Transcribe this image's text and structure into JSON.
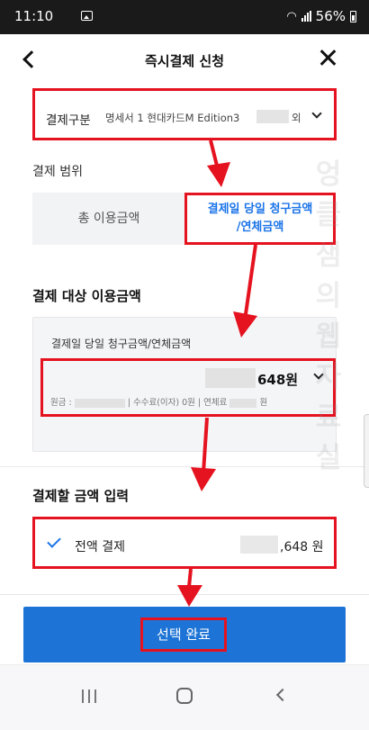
{
  "status_bar": {
    "time": "11:10",
    "battery": "56%"
  },
  "header": {
    "title": "즉시결제 신청"
  },
  "payment_type": {
    "label": "결제구분",
    "value": "명세서 1 현대카드M Edition3",
    "extra": "외"
  },
  "range": {
    "label": "결제 범위",
    "option_total": "총 이용금액",
    "option_due_line1": "결제일 당일 청구금액",
    "option_due_line2": "/연체금액"
  },
  "target": {
    "title": "결제 대상 이용금액",
    "card_label": "결제일 당일 청구금액/연체금액",
    "amount": "648원",
    "principal_label": "원금 :",
    "fee_text": "| 수수료(이자) 0원",
    "overdue_label": "| 연체료",
    "overdue_unit": "원"
  },
  "input": {
    "title": "결제할 금액 입력",
    "full_payment_label": "전액 결제",
    "full_payment_amount": ",648 원"
  },
  "confirm": {
    "label": "선택 완료"
  },
  "watermark": [
    "엉",
    "클",
    "샘",
    "의",
    "웹",
    "자",
    "료",
    "실"
  ],
  "colors": {
    "accent": "#1e74d6",
    "annotation": "#e5121f",
    "highlight_text": "#1a73e8"
  }
}
